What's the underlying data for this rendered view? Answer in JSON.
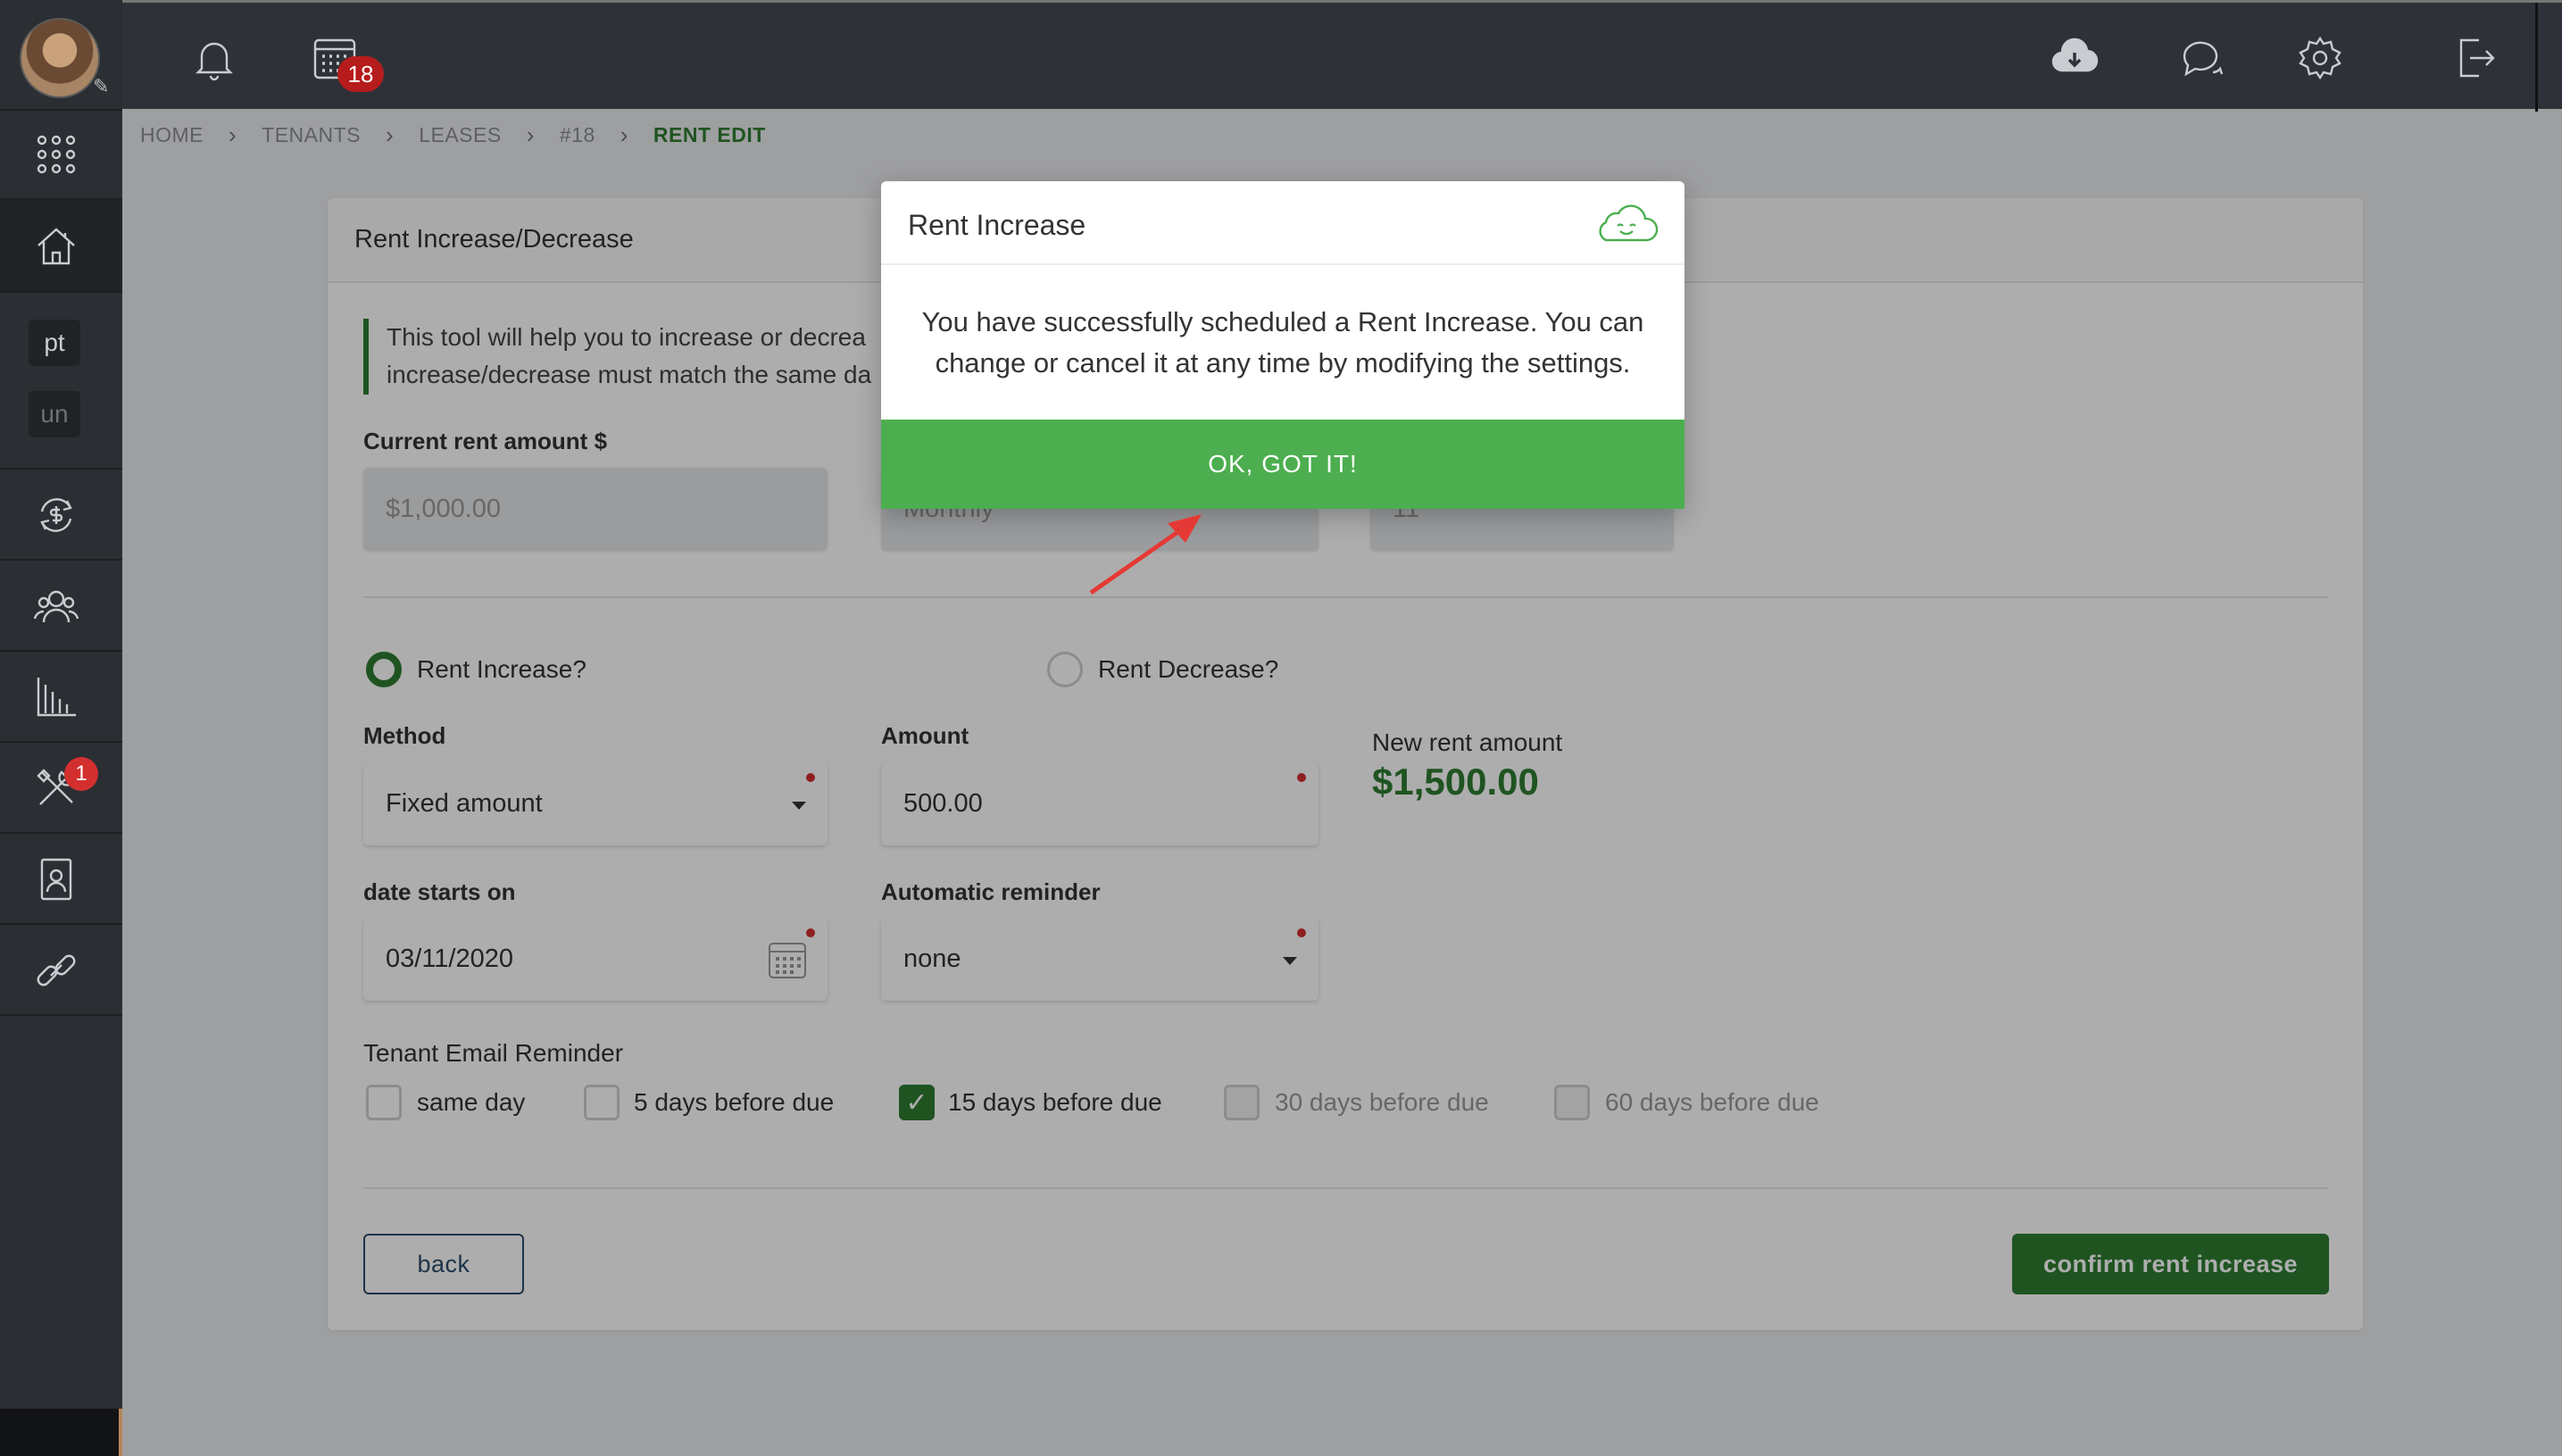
{
  "topbar": {
    "notification_count": "18"
  },
  "sidebar": {
    "chip_pt": "pt",
    "chip_un": "un",
    "tools_badge": "1"
  },
  "breadcrumb": {
    "items": [
      "HOME",
      "TENANTS",
      "LEASES",
      "#18"
    ],
    "current": "RENT EDIT"
  },
  "card": {
    "title": "Rent Increase/Decrease",
    "info_line1": "This tool will help you to increase or decrea",
    "info_line2": "increase/decrease must match the same da",
    "current_rent_label": "Current rent amount $",
    "current_rent_value": "$1,000.00",
    "frequency_value": "Monthly",
    "day_value": "11",
    "rent_increase_label": "Rent Increase?",
    "rent_decrease_label": "Rent Decrease?",
    "method_label": "Method",
    "method_value": "Fixed amount",
    "amount_label": "Amount",
    "amount_value": "500.00",
    "new_rent_label": "New rent amount",
    "new_rent_value": "$1,500.00",
    "date_label": "date starts on",
    "date_value": "03/11/2020",
    "reminder_label": "Automatic reminder",
    "reminder_value": "none",
    "email_reminder_label": "Tenant Email Reminder",
    "email_options": [
      {
        "label": "same day",
        "checked": false,
        "enabled": true
      },
      {
        "label": "5 days before due",
        "checked": false,
        "enabled": true
      },
      {
        "label": "15 days before due",
        "checked": true,
        "enabled": true
      },
      {
        "label": "30 days before due",
        "checked": false,
        "enabled": false
      },
      {
        "label": "60 days before due",
        "checked": false,
        "enabled": false
      }
    ],
    "back_label": "back",
    "confirm_label": "confirm rent increase"
  },
  "modal": {
    "title": "Rent Increase",
    "message_line1": "You have successfully scheduled a Rent Increase. You can",
    "message_line2": "change or cancel it at any time by modifying the settings.",
    "button_label": "OK, GOT IT!"
  },
  "colors": {
    "accent_green": "#2e7d32",
    "modal_button_green": "#4cae4f",
    "badge_red": "#d32f2f",
    "sidebar_bg": "#2b2e33"
  }
}
